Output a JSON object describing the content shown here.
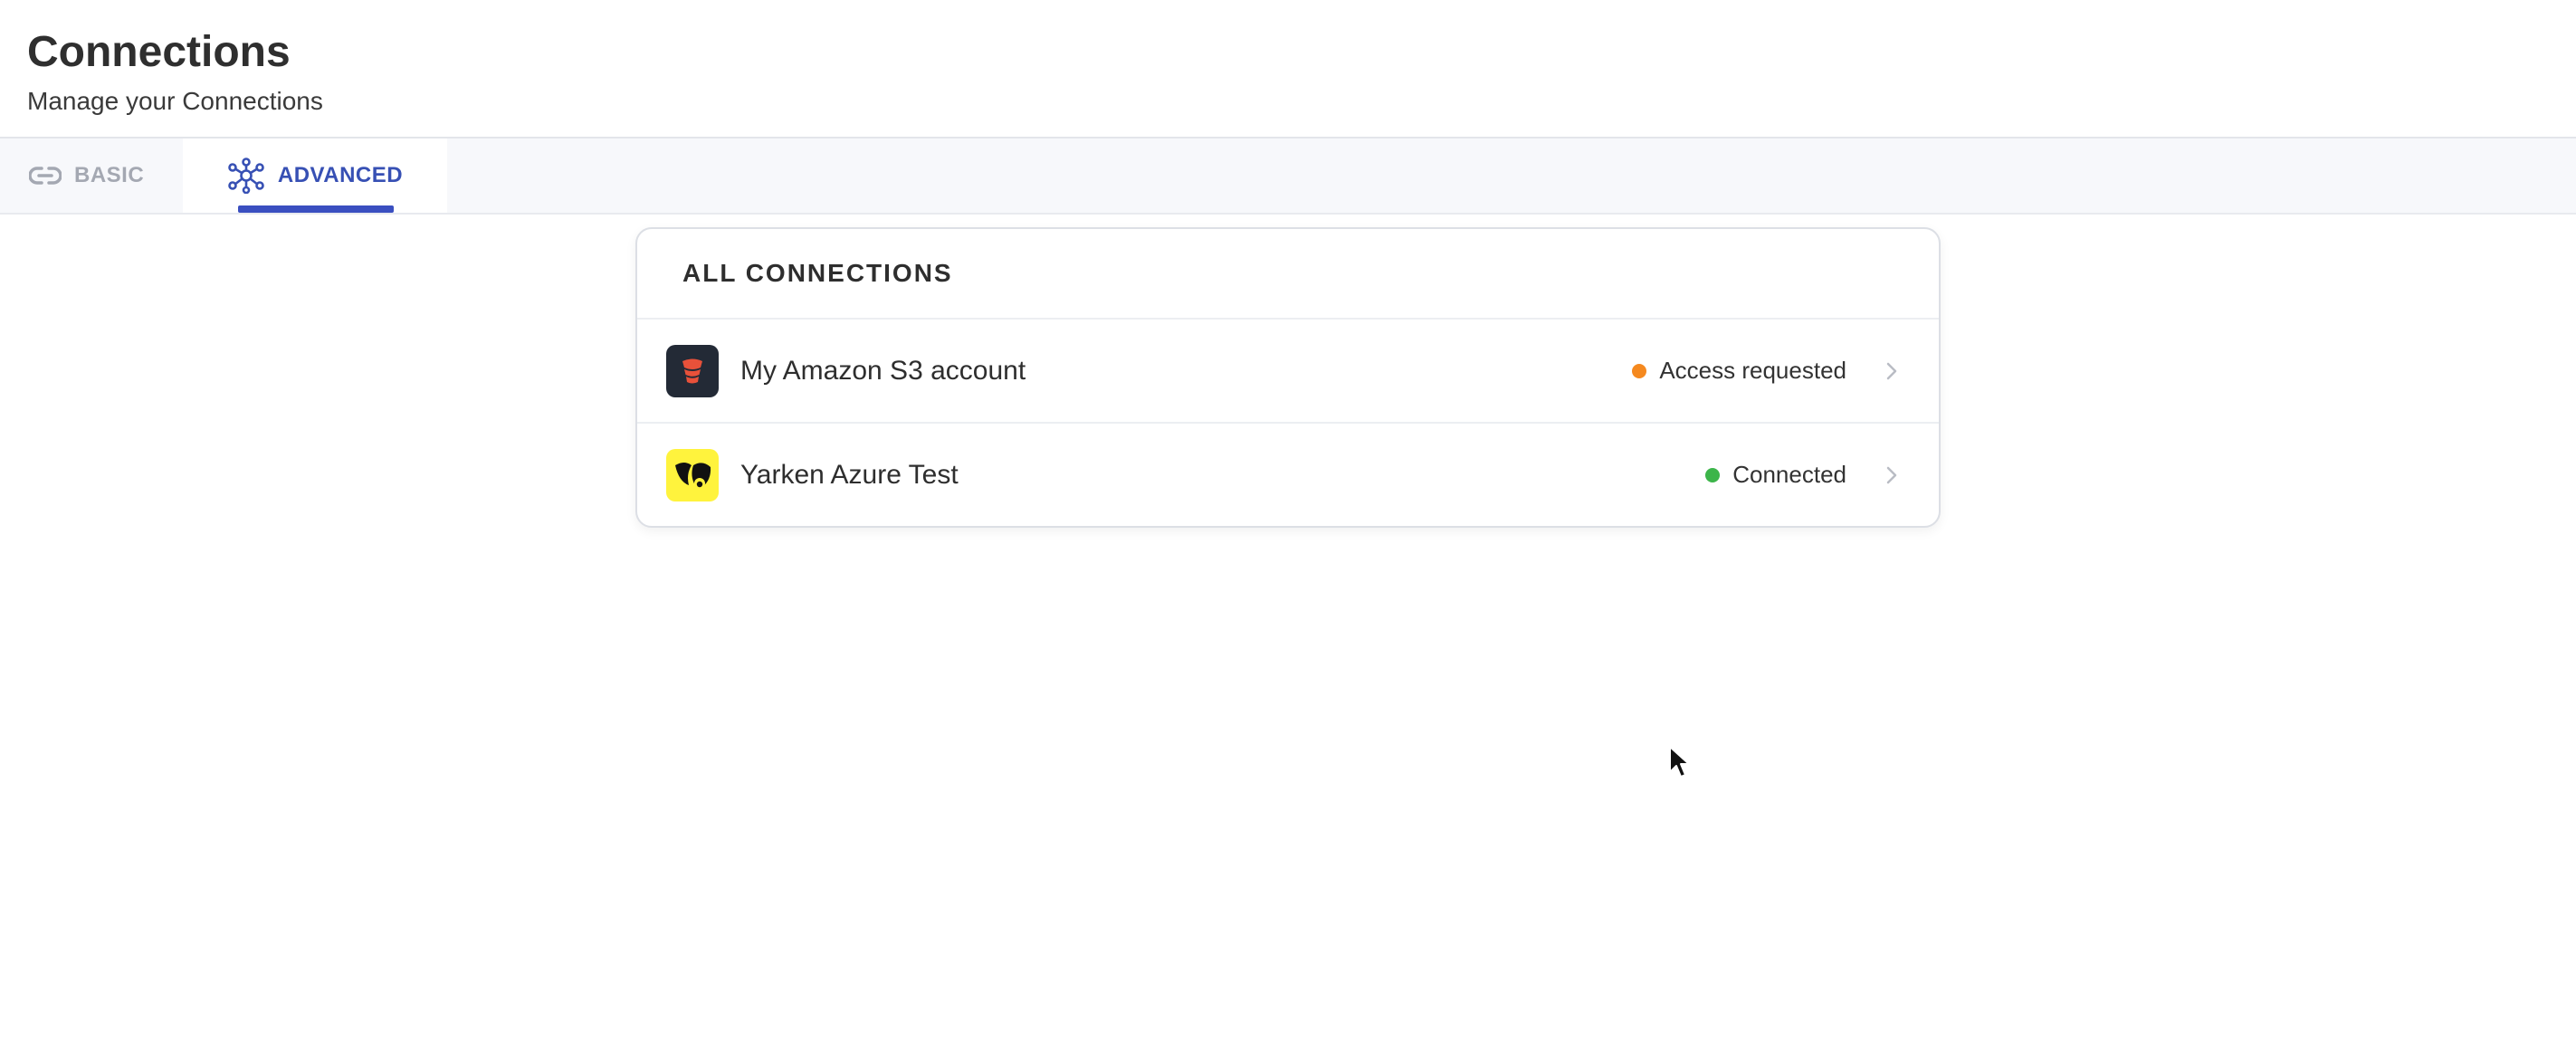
{
  "header": {
    "title": "Connections",
    "subtitle": "Manage your Connections"
  },
  "tabs": [
    {
      "label": "BASIC",
      "icon": "link-icon",
      "active": false
    },
    {
      "label": "ADVANCED",
      "icon": "network-icon",
      "active": true
    }
  ],
  "card": {
    "title": "ALL CONNECTIONS",
    "connections": [
      {
        "name": "My Amazon S3 account",
        "logo": "amazon-s3-logo",
        "status": "Access requested",
        "status_color": "#f5891f"
      },
      {
        "name": "Yarken Azure Test",
        "logo": "yarken-logo",
        "status": "Connected",
        "status_color": "#3cb54a"
      }
    ]
  },
  "colors": {
    "accent": "#3a4fc0",
    "tab_inactive": "#a4a8b2",
    "tab_bar_bg": "#f7f8fb"
  }
}
